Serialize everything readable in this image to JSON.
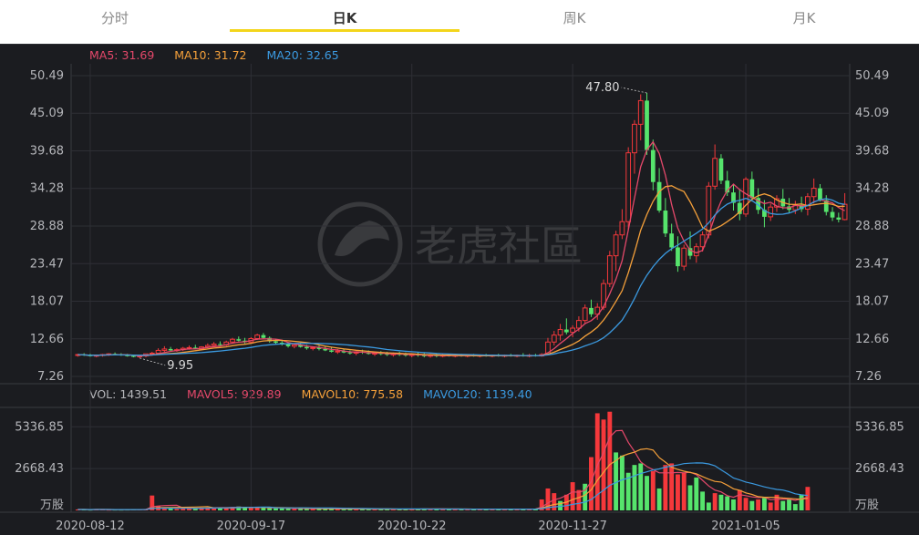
{
  "tabs": [
    {
      "label": "分时",
      "active": false
    },
    {
      "label": "日K",
      "active": true
    },
    {
      "label": "周K",
      "active": false
    },
    {
      "label": "月K",
      "active": false
    }
  ],
  "colors": {
    "up": "#f5383b",
    "down": "#56e46c",
    "ma5": "#e4486a",
    "ma10": "#f5a03a",
    "ma20": "#3b9ae1",
    "accent": "#f3d51b",
    "background": "#1b1c20",
    "grid": "#2e2f35",
    "axis_text": "#b5b6ba"
  },
  "price_legend": {
    "ma5_label": "MA5:",
    "ma5_value": "31.69",
    "ma10_label": "MA10:",
    "ma10_value": "31.72",
    "ma20_label": "MA20:",
    "ma20_value": "32.65"
  },
  "volume_legend": {
    "vol_label": "VOL:",
    "vol_value": "1439.51",
    "mavol5_label": "MAVOL5:",
    "mavol5_value": "929.89",
    "mavol10_label": "MAVOL10:",
    "mavol10_value": "775.58",
    "mavol20_label": "MAVOL20:",
    "mavol20_value": "1139.40"
  },
  "watermark": {
    "icon": "tiger-logo-icon",
    "text": "老虎社區"
  },
  "chart_data": [
    {
      "type": "candlestick",
      "title": "",
      "y_ticks": [
        "50.49",
        "45.09",
        "39.68",
        "34.28",
        "28.88",
        "23.47",
        "18.07",
        "12.66",
        "7.26"
      ],
      "ylim": [
        7.26,
        50.49
      ],
      "x_ticks": [
        "2020-08-12",
        "2020-09-17",
        "2020-10-22",
        "2020-11-27",
        "2021-01-05"
      ],
      "annotations": [
        {
          "label": "47.80",
          "kind": "high"
        },
        {
          "label": "9.95",
          "kind": "low"
        }
      ],
      "grid": true,
      "candles": [
        [
          10.3,
          10.5,
          10.1,
          10.4
        ],
        [
          10.4,
          10.6,
          10.2,
          10.3
        ],
        [
          10.3,
          10.5,
          10.1,
          10.2
        ],
        [
          10.2,
          10.4,
          10.0,
          10.3
        ],
        [
          10.3,
          10.5,
          10.1,
          10.4
        ],
        [
          10.4,
          10.6,
          10.2,
          10.5
        ],
        [
          10.5,
          10.7,
          10.3,
          10.4
        ],
        [
          10.4,
          10.6,
          10.2,
          10.3
        ],
        [
          10.3,
          10.5,
          10.1,
          10.2
        ],
        [
          10.2,
          10.4,
          10.0,
          10.1
        ],
        [
          10.1,
          10.3,
          9.9,
          10.2
        ],
        [
          10.2,
          10.4,
          10.0,
          10.5
        ],
        [
          10.5,
          10.8,
          10.3,
          10.6
        ],
        [
          10.6,
          11.3,
          10.4,
          11.0
        ],
        [
          11.0,
          11.6,
          10.8,
          11.2
        ],
        [
          11.2,
          11.5,
          10.9,
          11.0
        ],
        [
          11.0,
          11.3,
          10.8,
          11.1
        ],
        [
          11.1,
          11.5,
          10.9,
          11.3
        ],
        [
          11.3,
          11.7,
          11.1,
          11.4
        ],
        [
          11.4,
          11.8,
          11.2,
          11.2
        ],
        [
          11.2,
          11.6,
          11.0,
          11.5
        ],
        [
          11.5,
          12.0,
          11.3,
          11.7
        ],
        [
          11.7,
          12.2,
          11.5,
          11.9
        ],
        [
          11.9,
          12.3,
          11.6,
          11.8
        ],
        [
          11.8,
          12.4,
          11.6,
          12.2
        ],
        [
          12.2,
          12.8,
          12.0,
          12.6
        ],
        [
          12.6,
          13.0,
          12.3,
          12.4
        ],
        [
          12.4,
          12.8,
          12.0,
          12.2
        ],
        [
          12.2,
          12.9,
          12.1,
          12.7
        ],
        [
          12.7,
          13.4,
          12.5,
          13.2
        ],
        [
          13.2,
          13.5,
          12.6,
          12.8
        ],
        [
          12.8,
          13.0,
          12.1,
          12.3
        ],
        [
          12.3,
          12.6,
          11.9,
          12.1
        ],
        [
          12.1,
          12.4,
          11.7,
          11.9
        ],
        [
          11.9,
          12.2,
          11.4,
          11.6
        ],
        [
          11.6,
          12.0,
          11.3,
          11.8
        ],
        [
          11.8,
          12.1,
          11.4,
          11.5
        ],
        [
          11.5,
          11.8,
          11.1,
          11.3
        ],
        [
          11.3,
          11.6,
          11.0,
          11.4
        ],
        [
          11.4,
          11.7,
          11.0,
          11.2
        ],
        [
          11.2,
          11.5,
          10.9,
          11.0
        ],
        [
          11.0,
          11.4,
          10.7,
          10.8
        ],
        [
          10.8,
          11.2,
          10.5,
          10.9
        ],
        [
          10.9,
          11.2,
          10.6,
          10.7
        ],
        [
          10.7,
          11.0,
          10.4,
          10.6
        ],
        [
          10.6,
          10.9,
          10.3,
          10.8
        ],
        [
          10.8,
          11.1,
          10.5,
          10.7
        ],
        [
          10.7,
          11.0,
          10.4,
          10.5
        ],
        [
          10.5,
          10.8,
          10.2,
          10.6
        ],
        [
          10.6,
          10.9,
          10.3,
          10.5
        ],
        [
          10.5,
          10.8,
          10.2,
          10.4
        ],
        [
          10.4,
          10.7,
          10.1,
          10.5
        ],
        [
          10.5,
          10.8,
          10.2,
          10.4
        ],
        [
          10.4,
          10.7,
          10.1,
          10.3
        ],
        [
          10.3,
          10.6,
          10.0,
          10.4
        ],
        [
          10.4,
          10.7,
          10.1,
          10.3
        ],
        [
          10.3,
          10.6,
          10.0,
          10.2
        ],
        [
          10.2,
          10.5,
          9.95,
          10.3
        ],
        [
          10.3,
          10.6,
          10.0,
          10.2
        ],
        [
          10.2,
          10.5,
          10.0,
          10.3
        ],
        [
          10.3,
          10.5,
          10.1,
          10.2
        ],
        [
          10.2,
          10.4,
          10.0,
          10.3
        ],
        [
          10.3,
          10.5,
          10.1,
          10.2
        ],
        [
          10.2,
          10.4,
          10.0,
          10.3
        ],
        [
          10.3,
          10.5,
          10.1,
          10.2
        ],
        [
          10.2,
          10.4,
          10.0,
          10.3
        ],
        [
          10.3,
          10.5,
          10.1,
          10.2
        ],
        [
          10.2,
          10.4,
          10.0,
          10.3
        ],
        [
          10.3,
          10.5,
          10.1,
          10.2
        ],
        [
          10.2,
          10.4,
          10.0,
          10.3
        ],
        [
          10.3,
          10.5,
          10.1,
          10.2
        ],
        [
          10.2,
          10.4,
          10.0,
          10.3
        ],
        [
          10.3,
          10.6,
          10.1,
          10.2
        ],
        [
          10.2,
          10.5,
          10.0,
          10.3
        ],
        [
          10.3,
          10.5,
          10.1,
          10.2
        ],
        [
          10.2,
          10.6,
          10.1,
          10.4
        ],
        [
          10.4,
          12.8,
          10.3,
          12.2
        ],
        [
          12.2,
          13.8,
          11.7,
          13.2
        ],
        [
          13.2,
          14.8,
          12.4,
          14.0
        ],
        [
          14.0,
          15.6,
          13.3,
          13.6
        ],
        [
          13.6,
          14.6,
          12.9,
          14.2
        ],
        [
          14.2,
          15.9,
          13.7,
          15.3
        ],
        [
          15.3,
          17.6,
          14.8,
          17.1
        ],
        [
          17.1,
          18.3,
          15.8,
          16.2
        ],
        [
          16.2,
          17.8,
          15.4,
          17.2
        ],
        [
          17.2,
          21.2,
          16.8,
          20.6
        ],
        [
          20.6,
          25.3,
          20.1,
          24.6
        ],
        [
          24.6,
          28.2,
          22.4,
          27.6
        ],
        [
          27.6,
          31.3,
          27.0,
          29.5
        ],
        [
          29.5,
          40.2,
          28.3,
          39.4
        ],
        [
          39.4,
          44.1,
          36.4,
          43.5
        ],
        [
          43.5,
          47.8,
          41.2,
          46.9
        ],
        [
          46.9,
          48.0,
          39.1,
          39.8
        ],
        [
          39.8,
          41.3,
          34.0,
          35.2
        ],
        [
          35.2,
          37.2,
          30.8,
          31.1
        ],
        [
          31.1,
          32.9,
          27.3,
          27.8
        ],
        [
          27.8,
          29.2,
          25.3,
          25.8
        ],
        [
          25.8,
          27.4,
          22.3,
          23.1
        ],
        [
          23.1,
          26.2,
          22.5,
          25.7
        ],
        [
          25.7,
          28.1,
          24.1,
          24.6
        ],
        [
          24.6,
          26.4,
          23.6,
          25.9
        ],
        [
          25.9,
          28.1,
          25.2,
          27.6
        ],
        [
          27.6,
          35.2,
          27.1,
          34.6
        ],
        [
          34.6,
          40.6,
          34.1,
          38.6
        ],
        [
          38.6,
          39.2,
          34.9,
          35.4
        ],
        [
          35.4,
          36.8,
          33.2,
          33.7
        ],
        [
          33.7,
          34.9,
          31.1,
          32.2
        ],
        [
          32.2,
          34.2,
          29.7,
          30.6
        ],
        [
          30.6,
          35.9,
          30.2,
          35.6
        ],
        [
          35.6,
          36.7,
          32.4,
          32.9
        ],
        [
          32.9,
          34.3,
          30.6,
          31.2
        ],
        [
          31.2,
          32.6,
          28.7,
          30.2
        ],
        [
          30.2,
          32.1,
          29.6,
          31.6
        ],
        [
          31.6,
          33.3,
          30.9,
          32.8
        ],
        [
          32.8,
          34.2,
          31.3,
          31.7
        ],
        [
          31.7,
          32.9,
          30.8,
          31.2
        ],
        [
          31.2,
          32.5,
          30.6,
          31.9
        ],
        [
          31.9,
          33.1,
          30.9,
          31.3
        ],
        [
          31.3,
          33.6,
          30.4,
          33.1
        ],
        [
          33.1,
          35.7,
          32.1,
          34.3
        ],
        [
          34.3,
          34.9,
          32.4,
          32.6
        ],
        [
          32.6,
          33.3,
          30.4,
          30.9
        ],
        [
          30.9,
          31.6,
          29.6,
          30.1
        ],
        [
          30.1,
          30.8,
          29.4,
          29.8
        ],
        [
          29.8,
          33.6,
          29.7,
          32.0
        ]
      ]
    },
    {
      "type": "bar",
      "title": "",
      "y_ticks": [
        "5336.85",
        "2668.43"
      ],
      "y_unit": "万股",
      "ylim": [
        0,
        6400
      ],
      "values": [
        60,
        55,
        50,
        58,
        62,
        48,
        52,
        50,
        55,
        60,
        58,
        60,
        950,
        280,
        180,
        120,
        90,
        110,
        140,
        160,
        150,
        180,
        200,
        190,
        160,
        220,
        250,
        180,
        160,
        190,
        170,
        150,
        140,
        130,
        120,
        110,
        100,
        110,
        120,
        100,
        90,
        95,
        100,
        90,
        85,
        80,
        90,
        85,
        80,
        90,
        85,
        80,
        75,
        80,
        85,
        90,
        100,
        95,
        90,
        85,
        80,
        75,
        70,
        75,
        80,
        85,
        80,
        75,
        70,
        80,
        85,
        80,
        90,
        85,
        90,
        700,
        1400,
        1100,
        600,
        1000,
        1800,
        1300,
        1700,
        3400,
        6200,
        5800,
        6300,
        3700,
        3500,
        2400,
        2900,
        3000,
        2200,
        2500,
        1400,
        2900,
        3000,
        2300,
        2400,
        1600,
        2100,
        1200,
        500,
        1100,
        1000,
        900,
        700,
        1300,
        800,
        600,
        700,
        800,
        500,
        1000,
        600,
        700,
        400,
        1000,
        1500
      ],
      "up": [
        true,
        false,
        false,
        true,
        true,
        true,
        false,
        false,
        false,
        false,
        true,
        true,
        true,
        true,
        true,
        false,
        true,
        true,
        true,
        false,
        true,
        true,
        true,
        false,
        true,
        true,
        false,
        false,
        true,
        true,
        false,
        false,
        false,
        false,
        false,
        true,
        false,
        false,
        true,
        false,
        false,
        false,
        true,
        false,
        false,
        true,
        false,
        false,
        true,
        false,
        false,
        true,
        false,
        false,
        true,
        false,
        false,
        true,
        false,
        true,
        false,
        true,
        false,
        true,
        false,
        true,
        false,
        true,
        false,
        true,
        false,
        true,
        false,
        true,
        false,
        true,
        true,
        true,
        false,
        true,
        true,
        true,
        false,
        true,
        true,
        true,
        true,
        false,
        false,
        false,
        false,
        false,
        false,
        true,
        false,
        true,
        true,
        true,
        true,
        false,
        false,
        false,
        false,
        true,
        false,
        false,
        false,
        true,
        true,
        false,
        true,
        false,
        true,
        true,
        false,
        false,
        false,
        false,
        true
      ]
    }
  ]
}
